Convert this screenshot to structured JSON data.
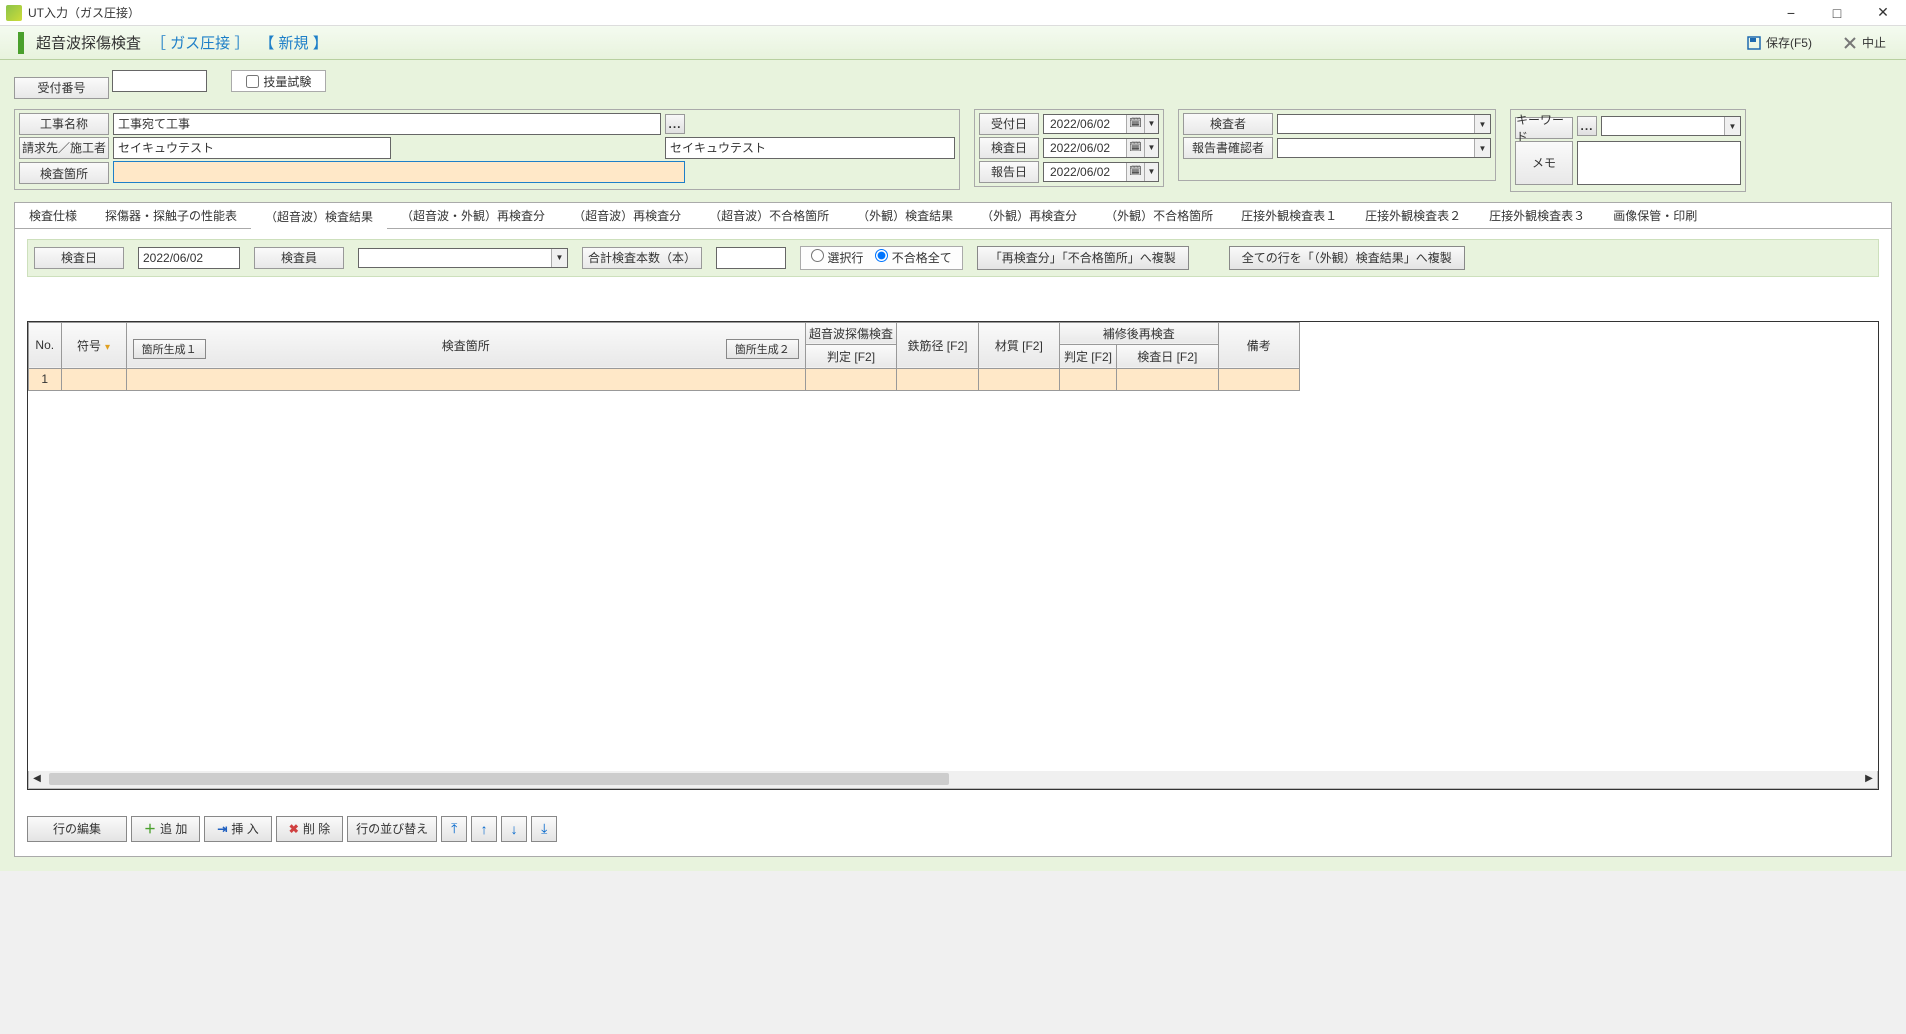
{
  "window": {
    "title": "UT入力（ガス圧接）"
  },
  "header": {
    "title": "超音波探傷検査",
    "mode1": "［ ガス圧接 ］",
    "mode2": "【 新規 】",
    "save_label": "保存(F5)",
    "cancel_label": "中止"
  },
  "top": {
    "accept_no_label": "受付番号",
    "accept_no_value": "",
    "skill_test_label": "技量試験"
  },
  "project": {
    "name_label": "工事名称",
    "name_value": "工事宛て工事",
    "billto_label": "請求先／施工者",
    "billto_value1": "セイキュウテスト",
    "billto_value2": "セイキュウテスト",
    "location_label": "検査箇所",
    "location_value": ""
  },
  "dates": {
    "accept_label": "受付日",
    "accept_value": "2022/06/02",
    "inspect_label": "検査日",
    "inspect_value": "2022/06/02",
    "report_label": "報告日",
    "report_value": "2022/06/02"
  },
  "people": {
    "inspector_label": "検査者",
    "inspector_value": "",
    "approver_label": "報告書確認者",
    "approver_value": ""
  },
  "meta": {
    "keyword_label": "キーワード",
    "keyword_value": "",
    "memo_label": "メモ",
    "memo_value": ""
  },
  "tabs": [
    "検査仕様",
    "探傷器・探触子の性能表",
    "（超音波）検査結果",
    "（超音波・外観）再検査分",
    "（超音波）再検査分",
    "（超音波）不合格箇所",
    "（外観）検査結果",
    "（外観）再検査分",
    "（外観）不合格箇所",
    "圧接外観検査表１",
    "圧接外観検査表２",
    "圧接外観検査表３",
    "画像保管・印刷"
  ],
  "filter": {
    "inspect_date_label": "検査日",
    "inspect_date_value": "2022/06/02",
    "inspector_label": "検査員",
    "inspector_value": "",
    "total_label": "合計検査本数（本）",
    "total_value": "",
    "radio_selected_label": "選択行",
    "radio_fail_all_label": "不合格全て",
    "copy_fail_btn": "「再検査分」「不合格箇所」へ複製",
    "copy_all_btn": "全ての行を「（外観）検査結果」へ複製"
  },
  "grid": {
    "cols": {
      "no": "No.",
      "code": "符号",
      "location": "検査箇所",
      "gen1_btn": "箇所生成１",
      "gen2_btn": "箇所生成２",
      "ut_group": "超音波探傷検査",
      "ut_judge": "判定 [F2]",
      "rebar": "鉄筋径 [F2]",
      "material": "材質 [F2]",
      "repair_group": "補修後再検査",
      "repair_judge": "判定 [F2]",
      "repair_date": "検査日 [F2]",
      "remarks": "備考"
    },
    "rows": [
      {
        "no": "1",
        "code": "",
        "location": "",
        "ut_judge": "",
        "rebar": "",
        "material": "",
        "repair_judge": "",
        "repair_date": "",
        "remarks": ""
      }
    ]
  },
  "bottom": {
    "edit_label": "行の編集",
    "add_label": "追 加",
    "insert_label": "挿 入",
    "delete_label": "削 除",
    "reorder_label": "行の並び替え"
  }
}
